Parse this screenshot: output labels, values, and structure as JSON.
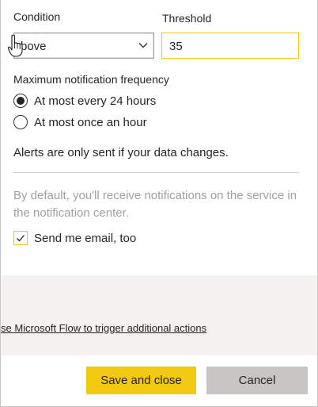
{
  "form": {
    "condition_label": "Condition",
    "condition_value": "bove",
    "threshold_label": "Threshold",
    "threshold_value": "35",
    "frequency_label": "Maximum notification frequency",
    "frequency_options": [
      {
        "label": "At most every 24 hours",
        "selected": true
      },
      {
        "label": "At most once an hour",
        "selected": false
      }
    ],
    "data_change_note": "Alerts are only sent if your data changes.",
    "default_note": "By default, you'll receive notifications on the service in the notification center.",
    "email_label": "Send me email, too",
    "email_checked": true
  },
  "footer": {
    "flow_link": "se Microsoft Flow to trigger additional actions",
    "save_label": "Save and close",
    "cancel_label": "Cancel"
  },
  "colors": {
    "accent": "#f2c811",
    "secondary_button": "#c8c6c4",
    "muted_text": "#a19f9d",
    "band": "#f3f2f1"
  },
  "icons": {
    "dropdown": "chevron-down-icon",
    "cursor": "hand-pointer-icon",
    "check": "checkmark-icon"
  }
}
